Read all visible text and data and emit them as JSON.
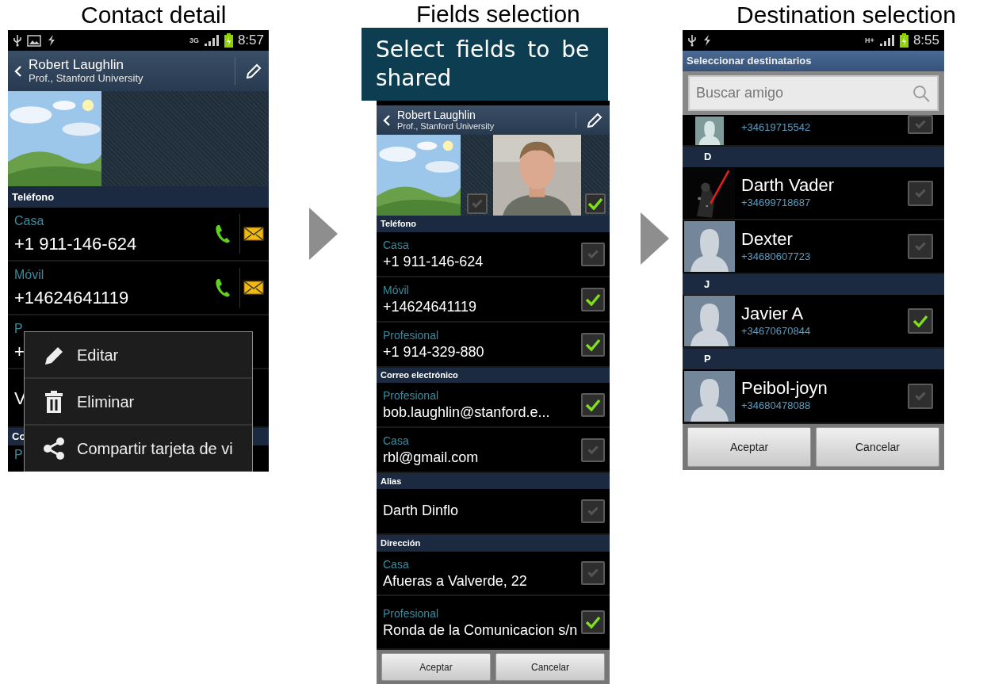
{
  "contact_detail": {
    "caption": "Contact detail",
    "status_bar": {
      "network": "3G",
      "time": "8:57"
    },
    "header": {
      "name": "Robert Laughlin",
      "subtitle": "Prof., Stanford University"
    },
    "sections": [
      {
        "title": "Teléfono",
        "rows": [
          {
            "kind": "callable",
            "label": "Casa",
            "value": "+1 911-146-624"
          },
          {
            "kind": "callable",
            "label": "Móvil",
            "value": "+14624641119"
          },
          {
            "kind": "plain",
            "label": "P",
            "value": "+"
          },
          {
            "kind": "plain",
            "value": "V"
          }
        ]
      },
      {
        "title": "Co",
        "rows": [
          {
            "kind": "plain",
            "label": "P"
          }
        ]
      }
    ],
    "menu": [
      {
        "kind": "edit",
        "label": "Editar"
      },
      {
        "kind": "delete",
        "label": "Eliminar"
      },
      {
        "kind": "share",
        "label": "Compartir tarjeta de vi"
      }
    ]
  },
  "fields_selection": {
    "caption": "Fields selection",
    "note": "Select fields to be shared",
    "header": {
      "name": "Robert Laughlin",
      "subtitle": "Prof., Stanford University"
    },
    "photos": [
      {
        "checked": false
      },
      {
        "checked": true
      }
    ],
    "sections": [
      {
        "title": "Teléfono",
        "rows": [
          {
            "label": "Casa",
            "value": "+1 911-146-624",
            "checked": false
          },
          {
            "label": "Móvil",
            "value": "+14624641119",
            "checked": true
          },
          {
            "label": "Profesional",
            "value": "+1 914-329-880",
            "checked": true
          }
        ]
      },
      {
        "title": "Correo electrónico",
        "rows": [
          {
            "label": "Profesional",
            "value": "bob.laughlin@stanford.e...",
            "checked": true
          },
          {
            "label": "Casa",
            "value": "rbl@gmail.com",
            "checked": false
          }
        ]
      },
      {
        "title": "Alias",
        "rows": [
          {
            "value": "Darth Dinflo",
            "checked": false
          }
        ]
      },
      {
        "title": "Dirección",
        "rows": [
          {
            "label": "Casa",
            "value": "Afueras a Valverde, 22",
            "checked": false
          },
          {
            "label": "Profesional",
            "value": "Ronda de la Comunicacion s/n",
            "checked": true
          }
        ]
      }
    ],
    "buttons": [
      "Aceptar",
      "Cancelar"
    ]
  },
  "destination_selection": {
    "caption": "Destination selection",
    "status_bar": {
      "network": "H+",
      "time": "8:55"
    },
    "title": "Seleccionar destinatarios",
    "search": {
      "placeholder": "Buscar amigo"
    },
    "list": [
      {
        "kind": "contact",
        "phone": "+34619715542",
        "checked": false,
        "has_photo": false
      },
      {
        "kind": "header",
        "letter": "D"
      },
      {
        "kind": "contact",
        "name": "Darth Vader",
        "phone": "+34699718687",
        "checked": false,
        "has_photo": true
      },
      {
        "kind": "contact",
        "name": "Dexter",
        "phone": "+34680607723",
        "checked": false,
        "has_photo": false
      },
      {
        "kind": "header",
        "letter": "J"
      },
      {
        "kind": "contact",
        "name": "Javier A",
        "phone": "+34670670844",
        "checked": true,
        "has_photo": false
      },
      {
        "kind": "header",
        "letter": "P"
      },
      {
        "kind": "contact",
        "name": "Peibol-joyn",
        "phone": "+34680478088",
        "checked": false,
        "has_photo": false
      }
    ],
    "buttons": [
      "Aceptar",
      "Cancelar"
    ]
  }
}
